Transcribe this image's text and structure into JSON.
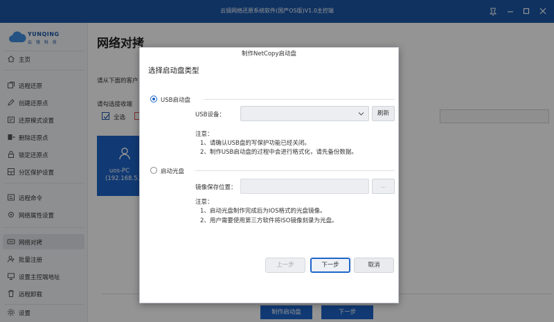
{
  "window": {
    "title": "云镜网络还原系统软件(国产OS版)V1.0主控端"
  },
  "brand": {
    "name": "YUNQING",
    "sub": "云 镜 科 技",
    "color": "#1a56a8"
  },
  "sidebar": {
    "items": [
      {
        "label": "主页",
        "icon": "home-icon"
      },
      {
        "label": "远程还原",
        "icon": "restore-icon"
      },
      {
        "label": "创建还原点",
        "icon": "create-point-icon"
      },
      {
        "label": "还原模式设置",
        "icon": "mode-settings-icon"
      },
      {
        "label": "删除还原点",
        "icon": "delete-point-icon"
      },
      {
        "label": "锁定还原点",
        "icon": "lock-icon"
      },
      {
        "label": "分区保护设置",
        "icon": "shield-icon"
      },
      {
        "label": "远程命令",
        "icon": "terminal-icon"
      },
      {
        "label": "网络属性设置",
        "icon": "network-settings-icon"
      },
      {
        "label": "网络对拷",
        "icon": "network-copy-icon"
      },
      {
        "label": "批量注册",
        "icon": "batch-register-icon"
      },
      {
        "label": "设置主控端地址",
        "icon": "address-icon"
      },
      {
        "label": "远程卸载",
        "icon": "uninstall-icon"
      },
      {
        "label": "设置",
        "icon": "settings-icon"
      }
    ],
    "active_index": 9
  },
  "main": {
    "title": "网络对拷",
    "hint_top": "请从下面的客户",
    "hint_select": "请勾选接收端",
    "select_all": "全选",
    "client": {
      "name": "uos-PC",
      "ip": "(192.168.5.1"
    },
    "buttons": {
      "make_boot": "制作启动盘",
      "next": "下一步"
    }
  },
  "dialog": {
    "title": "制作NetCopy启动盘",
    "header": "选择启动盘类型",
    "usb": {
      "label": "USB启动盘",
      "selected": true,
      "device_label": "USB设备：",
      "device_value": "",
      "refresh": "刷新",
      "note_title": "注意：",
      "notes": [
        "1、请确认USB盘的写保护功能已经关闭。",
        "2、制作USB启动盘的过程中会进行格式化，请先备份数据。"
      ]
    },
    "cd": {
      "label": "启动光盘",
      "selected": false,
      "path_label": "镜像保存位置：",
      "path_value": "",
      "browse": "...",
      "note_title": "注意：",
      "notes": [
        "1、启动光盘制作完成后为IOS格式的光盘镜像。",
        "2、用户需要使用第三方软件将ISO镜像刻录为光盘。"
      ]
    },
    "buttons": {
      "prev": "上一步",
      "next": "下一步",
      "cancel": "取消"
    }
  },
  "colors": {
    "primary": "#1e64c8",
    "titlebar": "#1a56a8"
  }
}
